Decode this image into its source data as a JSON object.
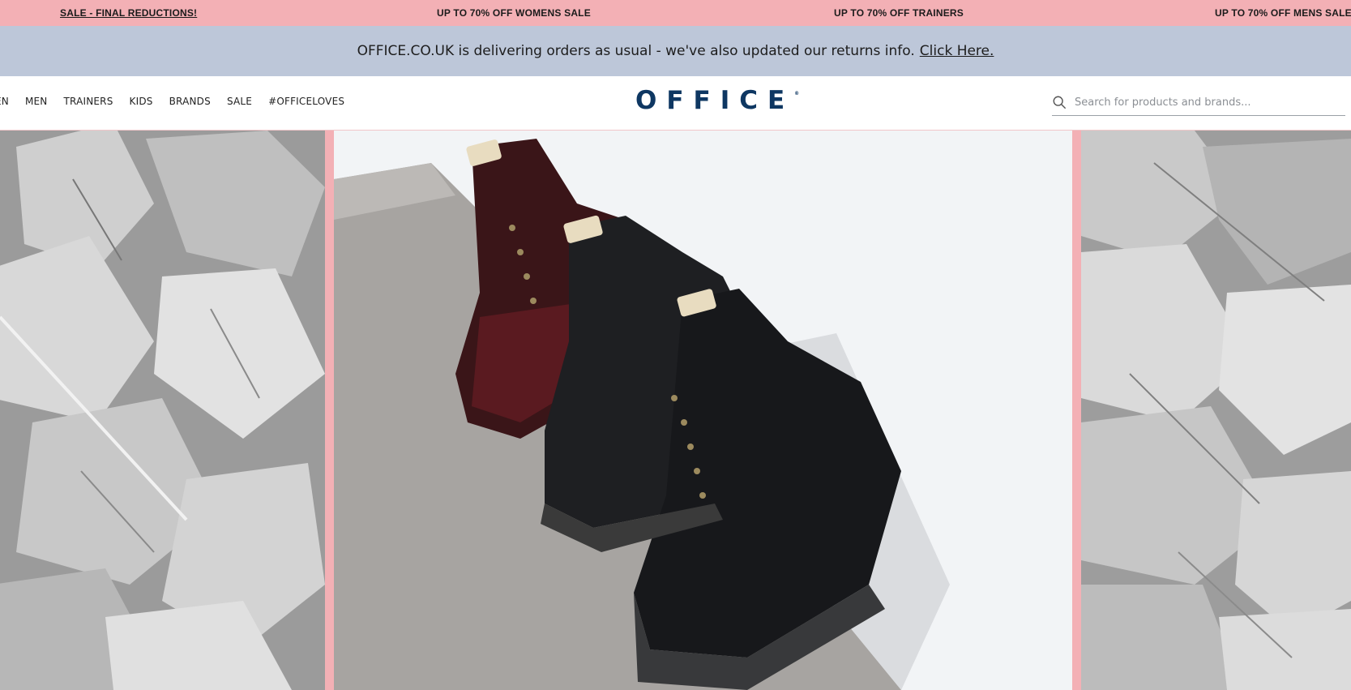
{
  "promo_bar": {
    "items": [
      "SALE - FINAL REDUCTIONS!",
      "UP TO 70% OFF WOMENS SALE",
      "UP TO 70% OFF TRAINERS",
      "UP TO 70% OFF MENS SALE"
    ],
    "background": "#f3b0b5"
  },
  "info_banner": {
    "text": "OFFICE.CO.UK is delivering orders as usual - we've also updated our returns info.",
    "link": "Click Here.",
    "background": "#bdc7d9"
  },
  "header": {
    "nav": [
      "EN",
      "MEN",
      "TRAINERS",
      "KIDS",
      "BRANDS",
      "SALE",
      "#OFFICELOVES"
    ],
    "logo": "OFFICE",
    "logo_color": "#0e3762",
    "search": {
      "placeholder": "Search for products and brands...",
      "value": "",
      "icon": "search-icon"
    }
  },
  "hero": {
    "left_panel": "leaves-photo",
    "center_panel": "boots-photo",
    "right_panel": "leaves-photo",
    "frame_color": "#f3b0b5"
  }
}
